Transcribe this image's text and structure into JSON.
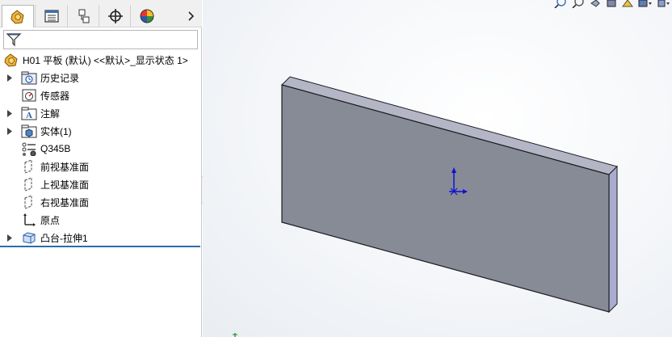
{
  "feature_tree": {
    "root": {
      "part_name": "H01 平板",
      "config": "(默认)",
      "display_state": "<<默认>_显示状态 1>"
    },
    "items": [
      {
        "label": "历史记录",
        "icon": "history-icon",
        "expandable": true
      },
      {
        "label": "传感器",
        "icon": "sensor-icon",
        "expandable": false
      },
      {
        "label": "注解",
        "icon": "annotation-icon",
        "expandable": true
      },
      {
        "label": "实体(1)",
        "icon": "solid-bodies-icon",
        "expandable": true
      },
      {
        "label": "Q345B",
        "icon": "material-icon",
        "expandable": false
      },
      {
        "label": "前视基准面",
        "icon": "plane-icon",
        "expandable": false
      },
      {
        "label": "上视基准面",
        "icon": "plane-icon",
        "expandable": false
      },
      {
        "label": "右视基准面",
        "icon": "plane-icon",
        "expandable": false
      },
      {
        "label": "原点",
        "icon": "origin-icon",
        "expandable": false
      },
      {
        "label": "凸台-拉伸1",
        "icon": "boss-extrude-icon",
        "expandable": true
      }
    ]
  },
  "tabs": [
    "feature-manager-tab",
    "property-manager-tab",
    "configuration-manager-tab",
    "dimxpert-tab",
    "display-manager-tab"
  ],
  "colors": {
    "panel_accent": "#2c6ea8",
    "model_face": "#868b96",
    "model_edge": "#1c1c22",
    "model_side": "#a9acce"
  }
}
